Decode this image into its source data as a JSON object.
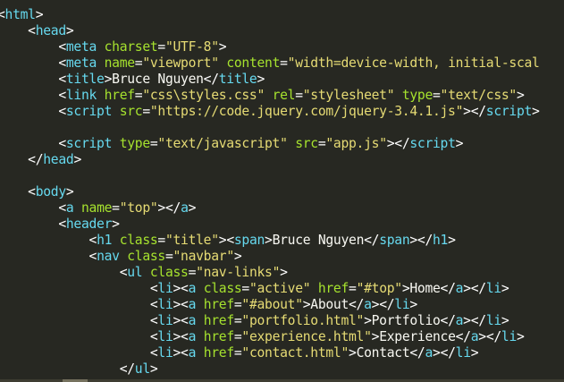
{
  "editor": {
    "theme": {
      "background": "#272822",
      "punctuation": "#ffffff",
      "tag": "#66d9ef",
      "attribute": "#a6e22e",
      "string": "#e6db74",
      "text": "#f8f8f2"
    },
    "lines": [
      [
        [
          "p",
          "<"
        ],
        [
          "tg",
          "html"
        ],
        [
          "p",
          ">"
        ]
      ],
      [
        [
          "w",
          "    "
        ],
        [
          "p",
          "<"
        ],
        [
          "tg",
          "head"
        ],
        [
          "p",
          ">"
        ]
      ],
      [
        [
          "w",
          "        "
        ],
        [
          "p",
          "<"
        ],
        [
          "tg",
          "meta"
        ],
        [
          "w",
          " "
        ],
        [
          "at",
          "charset"
        ],
        [
          "p",
          "="
        ],
        [
          "st",
          "\"UTF-8\""
        ],
        [
          "p",
          ">"
        ]
      ],
      [
        [
          "w",
          "        "
        ],
        [
          "p",
          "<"
        ],
        [
          "tg",
          "meta"
        ],
        [
          "w",
          " "
        ],
        [
          "at",
          "name"
        ],
        [
          "p",
          "="
        ],
        [
          "st",
          "\"viewport\""
        ],
        [
          "w",
          " "
        ],
        [
          "at",
          "content"
        ],
        [
          "p",
          "="
        ],
        [
          "st",
          "\"width=device-width, initial-scal"
        ]
      ],
      [
        [
          "w",
          "        "
        ],
        [
          "p",
          "<"
        ],
        [
          "tg",
          "title"
        ],
        [
          "p",
          ">"
        ],
        [
          "tx",
          "Bruce Nguyen"
        ],
        [
          "p",
          "</"
        ],
        [
          "tg",
          "title"
        ],
        [
          "p",
          ">"
        ]
      ],
      [
        [
          "w",
          "        "
        ],
        [
          "p",
          "<"
        ],
        [
          "tg",
          "link"
        ],
        [
          "w",
          " "
        ],
        [
          "at",
          "href"
        ],
        [
          "p",
          "="
        ],
        [
          "st",
          "\"css\\styles.css\""
        ],
        [
          "w",
          " "
        ],
        [
          "at",
          "rel"
        ],
        [
          "p",
          "="
        ],
        [
          "st",
          "\"stylesheet\""
        ],
        [
          "w",
          " "
        ],
        [
          "at",
          "type"
        ],
        [
          "p",
          "="
        ],
        [
          "st",
          "\"text/css\""
        ],
        [
          "p",
          ">"
        ]
      ],
      [
        [
          "w",
          "        "
        ],
        [
          "p",
          "<"
        ],
        [
          "tg",
          "script"
        ],
        [
          "w",
          " "
        ],
        [
          "at",
          "src"
        ],
        [
          "p",
          "="
        ],
        [
          "st",
          "\"https://code.jquery.com/jquery-3.4.1.js\""
        ],
        [
          "p",
          ">"
        ],
        [
          "p",
          "</"
        ],
        [
          "tg",
          "script"
        ],
        [
          "p",
          ">"
        ]
      ],
      [],
      [
        [
          "w",
          "        "
        ],
        [
          "p",
          "<"
        ],
        [
          "tg",
          "script"
        ],
        [
          "w",
          " "
        ],
        [
          "at",
          "type"
        ],
        [
          "p",
          "="
        ],
        [
          "st",
          "\"text/javascript\""
        ],
        [
          "w",
          " "
        ],
        [
          "at",
          "src"
        ],
        [
          "p",
          "="
        ],
        [
          "st",
          "\"app.js\""
        ],
        [
          "p",
          ">"
        ],
        [
          "p",
          "</"
        ],
        [
          "tg",
          "script"
        ],
        [
          "p",
          ">"
        ]
      ],
      [
        [
          "w",
          "    "
        ],
        [
          "p",
          "</"
        ],
        [
          "tg",
          "head"
        ],
        [
          "p",
          ">"
        ]
      ],
      [],
      [
        [
          "w",
          "    "
        ],
        [
          "p",
          "<"
        ],
        [
          "tg",
          "body"
        ],
        [
          "p",
          ">"
        ]
      ],
      [
        [
          "w",
          "        "
        ],
        [
          "p",
          "<"
        ],
        [
          "tg",
          "a"
        ],
        [
          "w",
          " "
        ],
        [
          "at",
          "name"
        ],
        [
          "p",
          "="
        ],
        [
          "st",
          "\"top\""
        ],
        [
          "p",
          ">"
        ],
        [
          "p",
          "</"
        ],
        [
          "tg",
          "a"
        ],
        [
          "p",
          ">"
        ]
      ],
      [
        [
          "w",
          "        "
        ],
        [
          "p",
          "<"
        ],
        [
          "tg",
          "header"
        ],
        [
          "p",
          ">"
        ]
      ],
      [
        [
          "w",
          "            "
        ],
        [
          "p",
          "<"
        ],
        [
          "tg",
          "h1"
        ],
        [
          "w",
          " "
        ],
        [
          "at",
          "class"
        ],
        [
          "p",
          "="
        ],
        [
          "st",
          "\"title\""
        ],
        [
          "p",
          ">"
        ],
        [
          "p",
          "<"
        ],
        [
          "tg",
          "span"
        ],
        [
          "p",
          ">"
        ],
        [
          "tx",
          "Bruce Nguyen"
        ],
        [
          "p",
          "</"
        ],
        [
          "tg",
          "span"
        ],
        [
          "p",
          ">"
        ],
        [
          "p",
          "</"
        ],
        [
          "tg",
          "h1"
        ],
        [
          "p",
          ">"
        ]
      ],
      [
        [
          "w",
          "            "
        ],
        [
          "p",
          "<"
        ],
        [
          "tg",
          "nav"
        ],
        [
          "w",
          " "
        ],
        [
          "at",
          "class"
        ],
        [
          "p",
          "="
        ],
        [
          "st",
          "\"navbar\""
        ],
        [
          "p",
          ">"
        ]
      ],
      [
        [
          "w",
          "                "
        ],
        [
          "p",
          "<"
        ],
        [
          "tg",
          "ul"
        ],
        [
          "w",
          " "
        ],
        [
          "at",
          "class"
        ],
        [
          "p",
          "="
        ],
        [
          "st",
          "\"nav-links\""
        ],
        [
          "p",
          ">"
        ]
      ],
      [
        [
          "w",
          "                    "
        ],
        [
          "p",
          "<"
        ],
        [
          "tg",
          "li"
        ],
        [
          "p",
          ">"
        ],
        [
          "p",
          "<"
        ],
        [
          "tg",
          "a"
        ],
        [
          "w",
          " "
        ],
        [
          "at",
          "class"
        ],
        [
          "p",
          "="
        ],
        [
          "st",
          "\"active\""
        ],
        [
          "w",
          " "
        ],
        [
          "at",
          "href"
        ],
        [
          "p",
          "="
        ],
        [
          "st",
          "\"#top\""
        ],
        [
          "p",
          ">"
        ],
        [
          "tx",
          "Home"
        ],
        [
          "p",
          "</"
        ],
        [
          "tg",
          "a"
        ],
        [
          "p",
          ">"
        ],
        [
          "p",
          "</"
        ],
        [
          "tg",
          "li"
        ],
        [
          "p",
          ">"
        ]
      ],
      [
        [
          "w",
          "                    "
        ],
        [
          "p",
          "<"
        ],
        [
          "tg",
          "li"
        ],
        [
          "p",
          ">"
        ],
        [
          "p",
          "<"
        ],
        [
          "tg",
          "a"
        ],
        [
          "w",
          " "
        ],
        [
          "at",
          "href"
        ],
        [
          "p",
          "="
        ],
        [
          "st",
          "\"#about\""
        ],
        [
          "p",
          ">"
        ],
        [
          "tx",
          "About"
        ],
        [
          "p",
          "</"
        ],
        [
          "tg",
          "a"
        ],
        [
          "p",
          ">"
        ],
        [
          "p",
          "</"
        ],
        [
          "tg",
          "li"
        ],
        [
          "p",
          ">"
        ]
      ],
      [
        [
          "w",
          "                    "
        ],
        [
          "p",
          "<"
        ],
        [
          "tg",
          "li"
        ],
        [
          "p",
          ">"
        ],
        [
          "p",
          "<"
        ],
        [
          "tg",
          "a"
        ],
        [
          "w",
          " "
        ],
        [
          "at",
          "href"
        ],
        [
          "p",
          "="
        ],
        [
          "st",
          "\"portfolio.html\""
        ],
        [
          "p",
          ">"
        ],
        [
          "tx",
          "Portfolio"
        ],
        [
          "p",
          "</"
        ],
        [
          "tg",
          "a"
        ],
        [
          "p",
          ">"
        ],
        [
          "p",
          "</"
        ],
        [
          "tg",
          "li"
        ],
        [
          "p",
          ">"
        ]
      ],
      [
        [
          "w",
          "                    "
        ],
        [
          "p",
          "<"
        ],
        [
          "tg",
          "li"
        ],
        [
          "p",
          ">"
        ],
        [
          "p",
          "<"
        ],
        [
          "tg",
          "a"
        ],
        [
          "w",
          " "
        ],
        [
          "at",
          "href"
        ],
        [
          "p",
          "="
        ],
        [
          "st",
          "\"experience.html\""
        ],
        [
          "p",
          ">"
        ],
        [
          "tx",
          "Experience"
        ],
        [
          "p",
          "</"
        ],
        [
          "tg",
          "a"
        ],
        [
          "p",
          ">"
        ],
        [
          "p",
          "</"
        ],
        [
          "tg",
          "li"
        ],
        [
          "p",
          ">"
        ]
      ],
      [
        [
          "w",
          "                    "
        ],
        [
          "p",
          "<"
        ],
        [
          "tg",
          "li"
        ],
        [
          "p",
          ">"
        ],
        [
          "p",
          "<"
        ],
        [
          "tg",
          "a"
        ],
        [
          "w",
          " "
        ],
        [
          "at",
          "href"
        ],
        [
          "p",
          "="
        ],
        [
          "st",
          "\"contact.html\""
        ],
        [
          "p",
          ">"
        ],
        [
          "tx",
          "Contact"
        ],
        [
          "p",
          "</"
        ],
        [
          "tg",
          "a"
        ],
        [
          "p",
          ">"
        ],
        [
          "p",
          "</"
        ],
        [
          "tg",
          "li"
        ],
        [
          "p",
          ">"
        ]
      ],
      [
        [
          "w",
          "                "
        ],
        [
          "p",
          "</"
        ],
        [
          "tg",
          "ul"
        ],
        [
          "p",
          ">"
        ]
      ]
    ]
  }
}
